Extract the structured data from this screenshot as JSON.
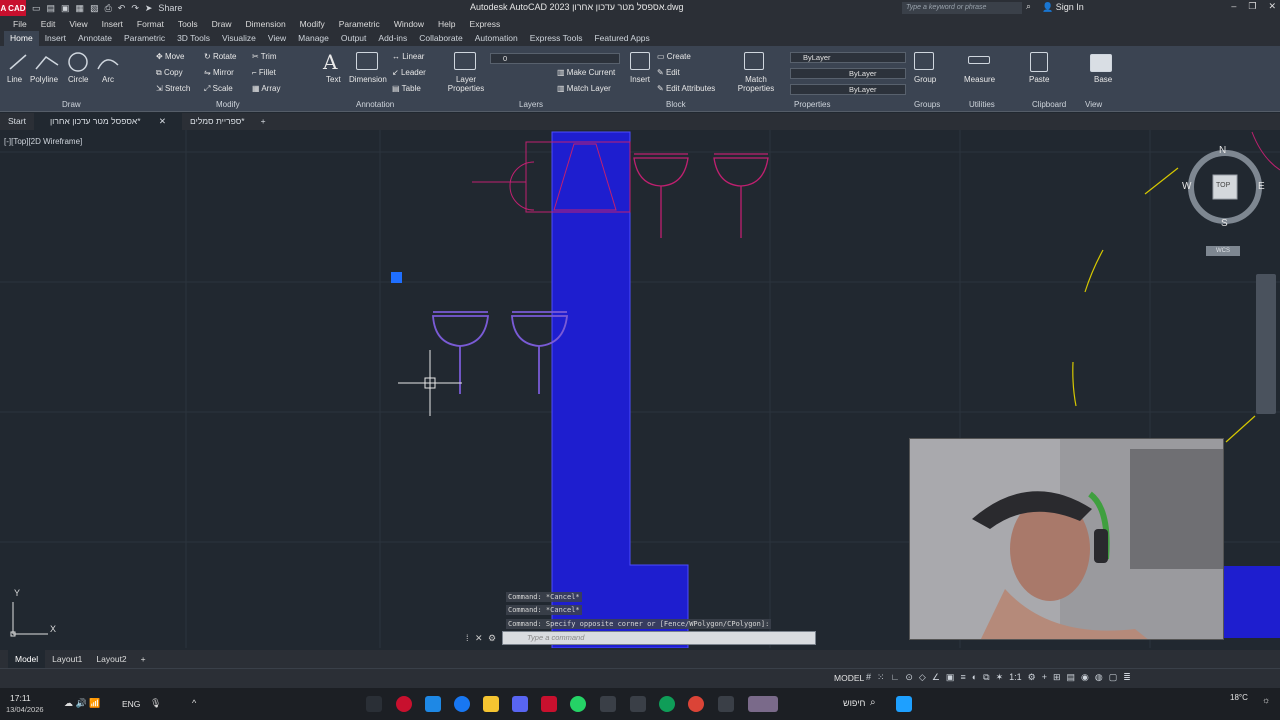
{
  "app": {
    "logo_text": "A CAD",
    "title": "Autodesk AutoCAD 2023  אספסל מטר עדכון אחרון.dwg",
    "share_label": "Share",
    "search_placeholder": "Type a keyword or phrase",
    "signin_label": "Sign In"
  },
  "menu": [
    "File",
    "Edit",
    "View",
    "Insert",
    "Format",
    "Tools",
    "Draw",
    "Dimension",
    "Modify",
    "Parametric",
    "Window",
    "Help",
    "Express"
  ],
  "ribbon_tabs": [
    "Home",
    "Insert",
    "Annotate",
    "Parametric",
    "3D Tools",
    "Visualize",
    "View",
    "Manage",
    "Output",
    "Add-ins",
    "Collaborate",
    "Automation",
    "Express Tools",
    "Featured Apps"
  ],
  "ribbon": {
    "draw": {
      "line": "Line",
      "polyline": "Polyline",
      "circle": "Circle",
      "arc": "Arc",
      "panel": "Draw"
    },
    "modify": {
      "move": "Move",
      "rotate": "Rotate",
      "trim": "Trim",
      "copy": "Copy",
      "mirror": "Mirror",
      "fillet": "Fillet",
      "stretch": "Stretch",
      "scale": "Scale",
      "array": "Array",
      "panel": "Modify"
    },
    "annotation": {
      "text": "Text",
      "dimension": "Dimension",
      "linear": "Linear",
      "leader": "Leader",
      "table": "Table",
      "panel": "Annotation"
    },
    "layers": {
      "layer_properties": "Layer Properties",
      "make_current": "Make Current",
      "match_layer": "Match Layer",
      "layer_value": "0",
      "panel": "Layers"
    },
    "block": {
      "insert": "Insert",
      "create": "Create",
      "edit": "Edit",
      "edit_attributes": "Edit Attributes",
      "panel": "Block"
    },
    "properties": {
      "match_properties": "Match Properties",
      "bylayer1": "ByLayer",
      "bylayer2": "ByLayer",
      "bylayer3": "ByLayer",
      "panel": "Properties"
    },
    "groups": {
      "group": "Group",
      "panel": "Groups"
    },
    "utilities": {
      "measure": "Measure",
      "panel": "Utilities"
    },
    "clipboard": {
      "paste": "Paste",
      "panel": "Clipboard"
    },
    "view": {
      "base": "Base",
      "panel": "View"
    }
  },
  "file_tabs": [
    "Start",
    "אספסל מטר עדכון אחרון*",
    "ספריית סמלים*"
  ],
  "viewport_label": "[-][Top][2D Wireframe]",
  "viewcube": {
    "n": "N",
    "s": "S",
    "e": "E",
    "w": "W",
    "top": "TOP",
    "wcs": "WCS"
  },
  "ucs": {
    "x": "X",
    "y": "Y"
  },
  "command_history": [
    "Command: *Cancel*",
    "Command: *Cancel*",
    "Command: Specify opposite corner or [Fence/WPolygon/CPolygon]:"
  ],
  "command_placeholder": "Type a command",
  "layout_tabs": [
    "Model",
    "Layout1",
    "Layout2"
  ],
  "status": {
    "model_label": "MODEL",
    "scale": "1:1"
  },
  "taskbar": {
    "time": "17:11",
    "date": "13/04/2026",
    "lang": "ENG",
    "weather": "18°C",
    "search_text": "חיפוש"
  },
  "colors": {
    "wall_fill": "#1e1ecf",
    "magenta": "#c02070",
    "purple": "#7a5bd6",
    "yellow": "#d6c800",
    "ribbon_bg": "#3b4452",
    "canvas_bg": "#212830"
  }
}
